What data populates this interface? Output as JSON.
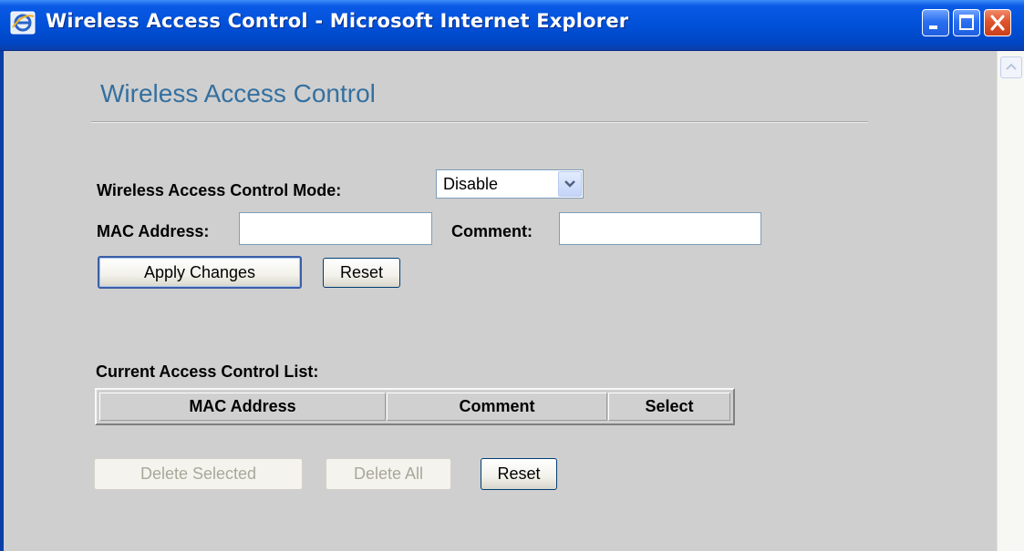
{
  "window": {
    "title": "Wireless Access Control - Microsoft Internet Explorer",
    "app_icon": "ie-icon",
    "controls": [
      "minimize-icon",
      "maximize-icon",
      "close-icon"
    ]
  },
  "page": {
    "heading": "Wireless Access Control",
    "mode": {
      "label": "Wireless Access Control Mode:",
      "selected": "Disable"
    },
    "mac_field": {
      "label": "MAC Address:",
      "value": "",
      "placeholder": ""
    },
    "comment_field": {
      "label": "Comment:",
      "value": "",
      "placeholder": ""
    },
    "apply_button": "Apply Changes",
    "reset_button": "Reset",
    "list": {
      "title": "Current Access Control List:",
      "columns": [
        "MAC Address",
        "Comment",
        "Select"
      ],
      "rows": []
    },
    "delete_selected_button": "Delete Selected",
    "delete_all_button": "Delete All",
    "list_reset_button": "Reset"
  }
}
